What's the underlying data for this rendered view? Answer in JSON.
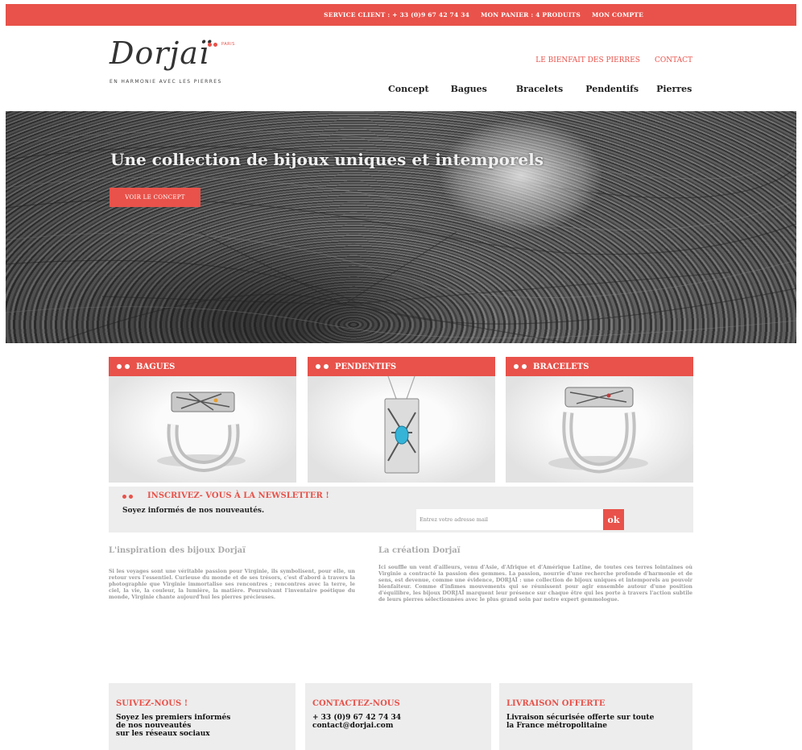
{
  "topbar": {
    "service_client": "SERVICE CLIENT : + 33 (0)9 67 42 74 34",
    "panier": "MON PANIER : 4 PRODUITS",
    "compte": "MON COMPTE"
  },
  "brand": {
    "name": "Dorjaï",
    "paris": "PARIS",
    "tagline": "EN HARMONIE AVEC LES PIERRES"
  },
  "header_links": [
    "LE BIENFAIT DES PIERRES",
    "CONTACT"
  ],
  "nav": [
    "Concept",
    "Bagues",
    "Bracelets",
    "Pendentifs",
    "Pierres"
  ],
  "hero": {
    "title": "Une collection de bijoux uniques et intemporels",
    "cta": "VOIR LE CONCEPT"
  },
  "categories": [
    {
      "label": "BAGUES"
    },
    {
      "label": "PENDENTIFS"
    },
    {
      "label": "BRACELETS"
    }
  ],
  "newsletter": {
    "title": "INSCRIVEZ- VOUS À LA NEWSLETTER !",
    "subtitle": "Soyez informés de nos nouveautés.",
    "placeholder": "Entrez votre adresse mail",
    "button": "ok"
  },
  "articles": [
    {
      "title": "L'inspiration des bijoux Dorjaï",
      "body": "Si les voyages sont une véritable passion pour Virginie, ils symbolisent, pour elle, un retour vers l'essentiel. Curieuse du monde et de ses trésors, c'est d'abord à travers la photographie que Virginie immortalise ses rencontres ; rencontres avec la terre, le ciel, la vie, la couleur, la lumière, la matière. Poursuivant l'inventaire poétique du monde, Virginie chante aujourd'hui les pierres précieuses."
    },
    {
      "title": "La création Dorjaï",
      "body": "Ici souffle un vent d'ailleurs, venu d'Asie, d'Afrique et d'Amérique Latine, de toutes ces terres lointaines où Virginie a contracté la passion des gemmes. La passion, nourrie d'une recherche profonde d'harmonie et de sens, est devenue, comme une évidence, DORJAÏ : une collection de bijoux uniques et intemporels au pouvoir bienfaiteur. Comme d'infimes mouvements qui se réunissent pour agir ensemble autour d'une position d'équilibre, les bijoux DORJAÏ marquent leur présence sur chaque être qui les porte à travers l'action subtile de leurs pierres sélectionnées avec le plus grand soin par notre expert gemmologue."
    }
  ],
  "footer": [
    {
      "title": "SUIVEZ-NOUS !",
      "text": "Soyez les premiers informés\nde nos nouveautés\nsur les réseaux sociaux"
    },
    {
      "title": "CONTACTEZ-NOUS",
      "text": "+ 33 (0)9 67 42 74 34\ncontact@dorjai.com"
    },
    {
      "title": "LIVRAISON OFFERTE",
      "text": "Livraison sécurisée offerte sur toute\nla France métropolitaine"
    }
  ],
  "colors": {
    "accent": "#e8524a",
    "panel": "#ededed"
  }
}
